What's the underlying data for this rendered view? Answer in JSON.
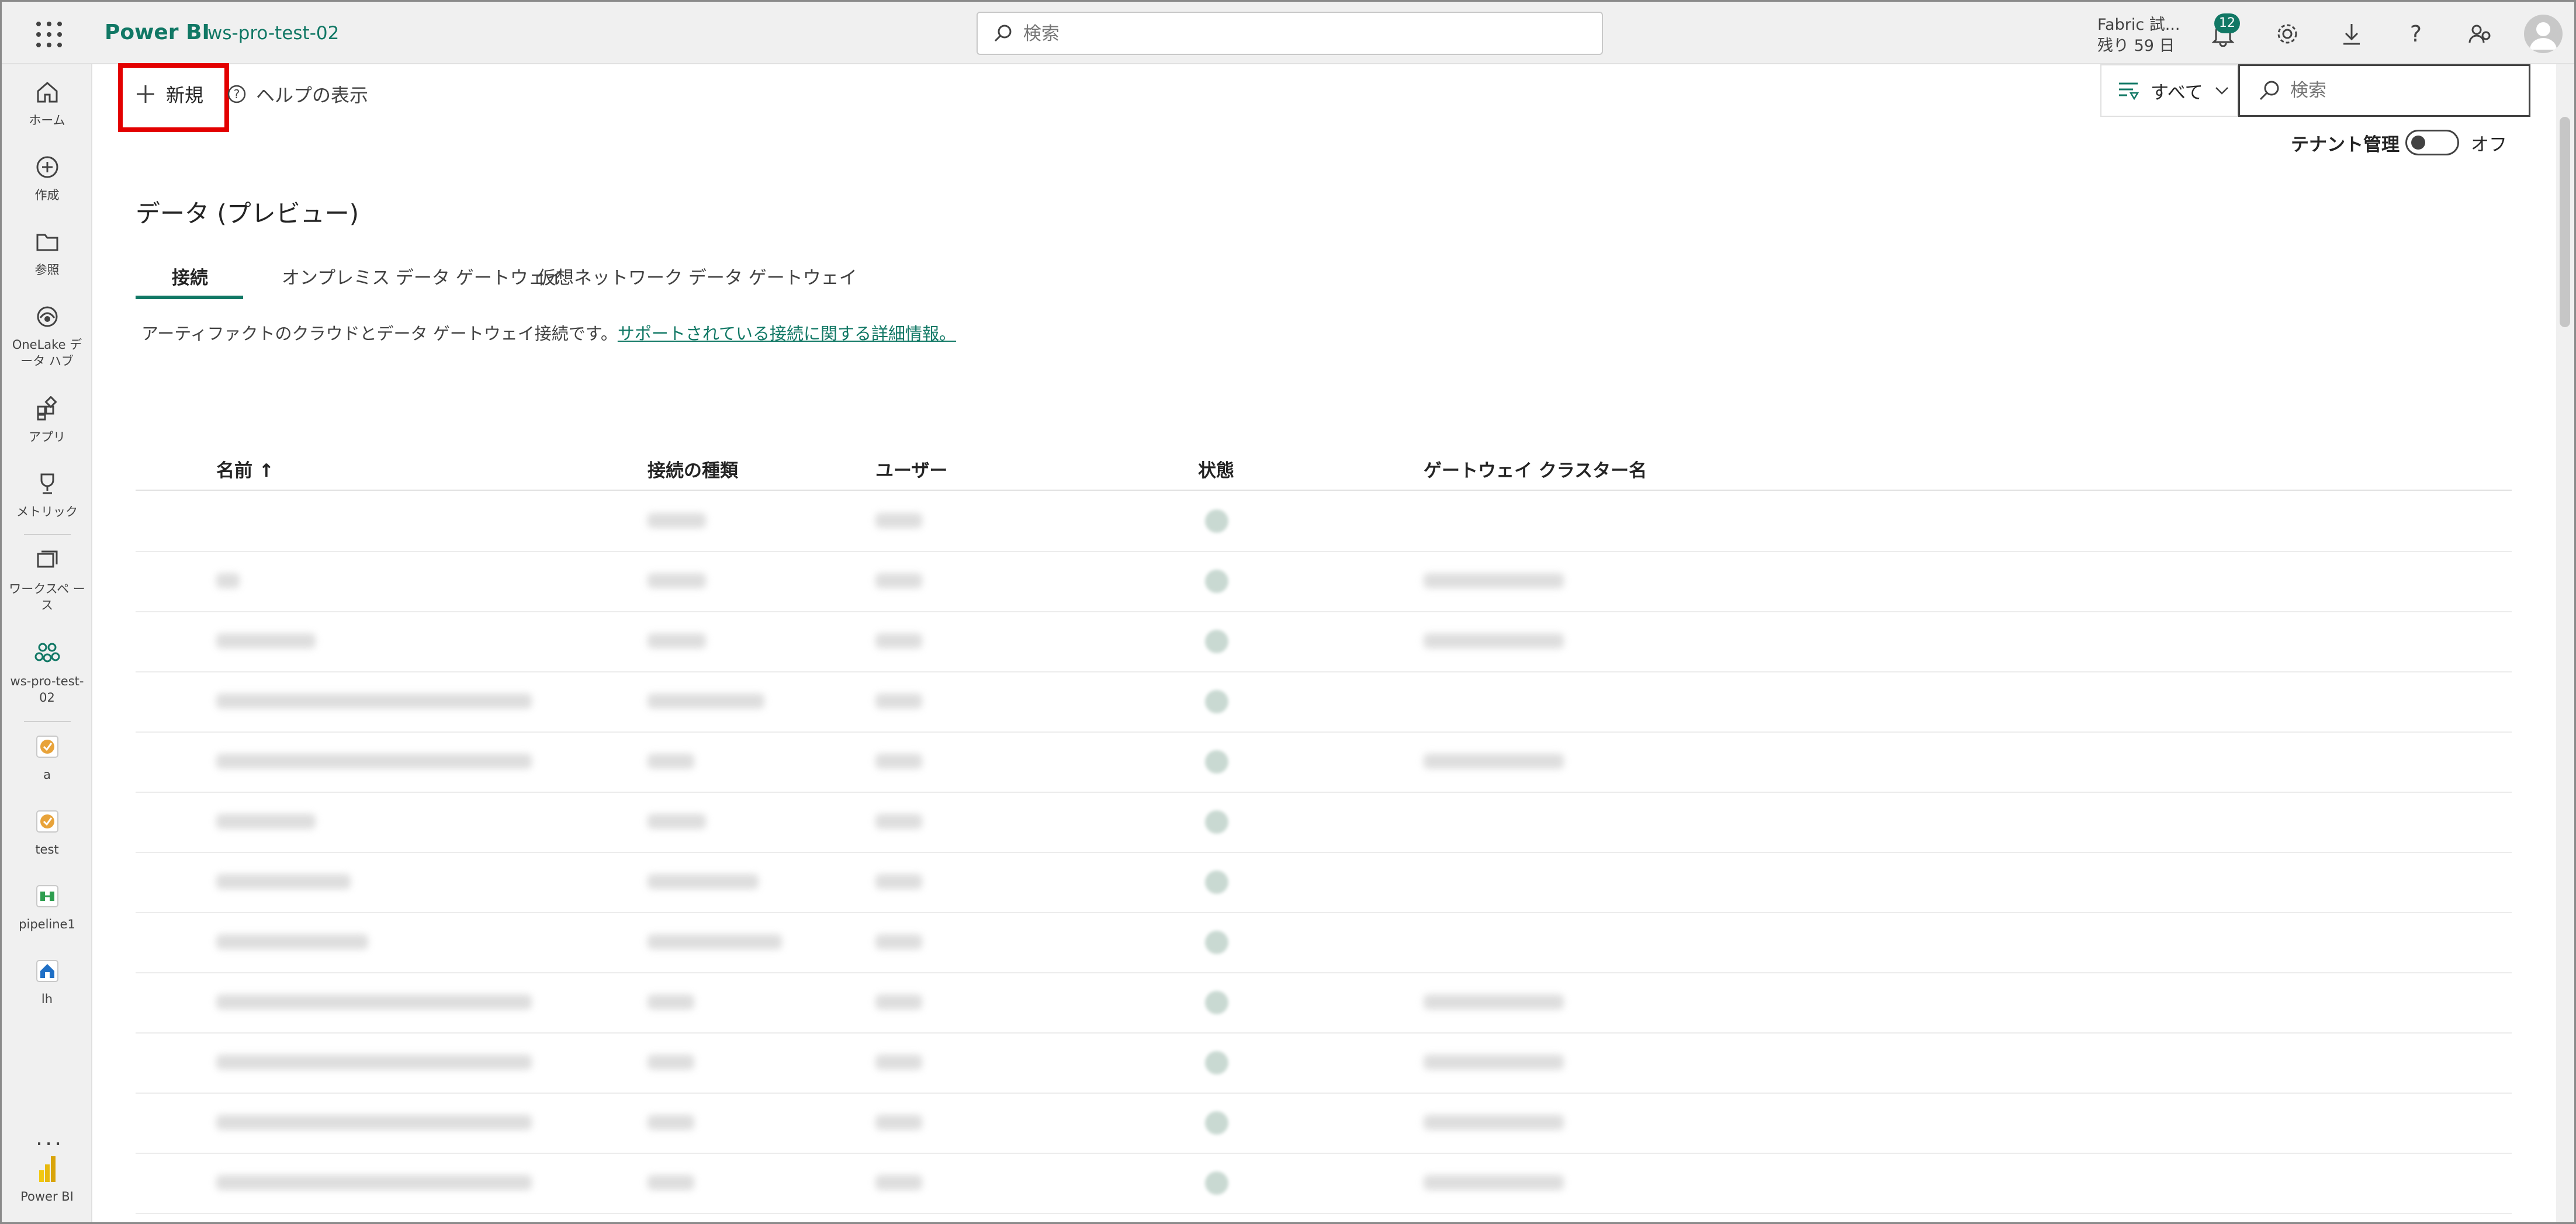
{
  "header": {
    "app_name": "Power BI",
    "workspace": "ws-pro-test-02",
    "search_placeholder": "検索",
    "trial_line1": "Fabric 試...",
    "trial_line2": "残り 59 日",
    "notification_count": "12"
  },
  "leftnav": {
    "items": [
      {
        "label": "ホーム",
        "icon": "home-icon"
      },
      {
        "label": "作成",
        "icon": "create-icon"
      },
      {
        "label": "参照",
        "icon": "browse-icon"
      },
      {
        "label": "OneLake デ ータ ハブ",
        "icon": "onelake-icon"
      },
      {
        "label": "アプリ",
        "icon": "apps-icon"
      },
      {
        "label": "メトリック",
        "icon": "metrics-icon"
      },
      {
        "label": "ワークスペ ース",
        "icon": "workspaces-icon"
      },
      {
        "label": "ws-pro-test-02",
        "icon": "workspace-group-icon"
      },
      {
        "label": "a",
        "icon": "item-a-icon"
      },
      {
        "label": "test",
        "icon": "item-test-icon"
      },
      {
        "label": "pipeline1",
        "icon": "pipeline-icon"
      },
      {
        "label": "lh",
        "icon": "lakehouse-icon"
      }
    ],
    "more": "...",
    "footer": "Power BI"
  },
  "toolbar": {
    "new_label": "新規",
    "help_label": "ヘルプの表示",
    "filter_label": "すべて",
    "search_placeholder": "検索",
    "tenant_label": "テナント管理",
    "toggle_state": "オフ"
  },
  "page": {
    "title": "データ (プレビュー)",
    "tabs": [
      "接続",
      "オンプレミス データ ゲートウェイ",
      "仮想ネットワーク データ ゲートウェイ"
    ],
    "description": "アーティファクトのクラウドとデータ ゲートウェイ接続です。",
    "description_link": "サポートされている接続に関する詳細情報。"
  },
  "table": {
    "columns": [
      "名前 ↑",
      "接続の種類",
      "ユーザー",
      "状態",
      "ゲートウェイ クラスター名"
    ]
  }
}
